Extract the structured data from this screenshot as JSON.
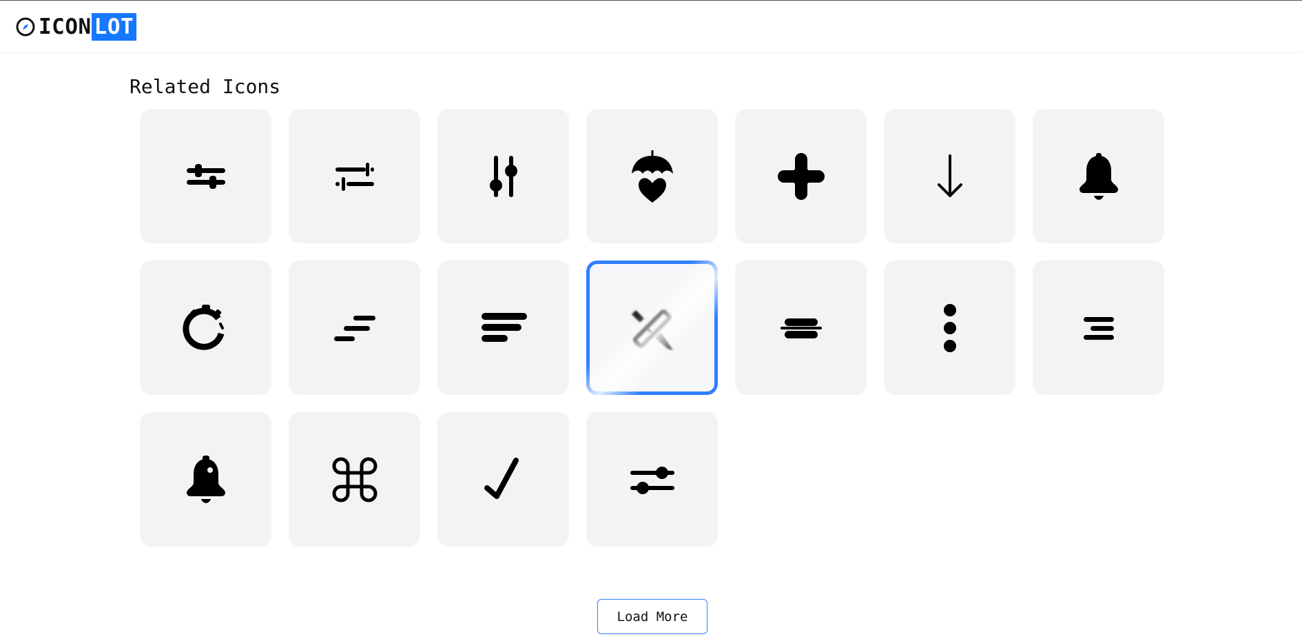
{
  "header": {
    "logo_text_primary": "ICON",
    "logo_text_highlight": "LOT",
    "logo_icon": "compass-icon",
    "accent_color": "#1677ff"
  },
  "main": {
    "section_title": "Related Icons",
    "icons": [
      {
        "icon": "sliders-horizontal-icon"
      },
      {
        "icon": "settings-adjust-icon"
      },
      {
        "icon": "sliders-vertical-icon"
      },
      {
        "icon": "umbrella-heart-icon"
      },
      {
        "icon": "plus-bold-icon"
      },
      {
        "icon": "arrow-down-icon"
      },
      {
        "icon": "bell-icon"
      },
      {
        "icon": "timer-icon"
      },
      {
        "icon": "sort-lines-icon"
      },
      {
        "icon": "align-left-icon"
      },
      {
        "icon": "ruler-pencil-icon",
        "selected": true
      },
      {
        "icon": "strikethrough-icon"
      },
      {
        "icon": "more-vertical-icon"
      },
      {
        "icon": "align-right-icon"
      },
      {
        "icon": "bell-ring-icon"
      },
      {
        "icon": "command-icon"
      },
      {
        "icon": "check-icon"
      },
      {
        "icon": "toggle-sliders-icon"
      }
    ],
    "load_more_label": "Load More"
  }
}
